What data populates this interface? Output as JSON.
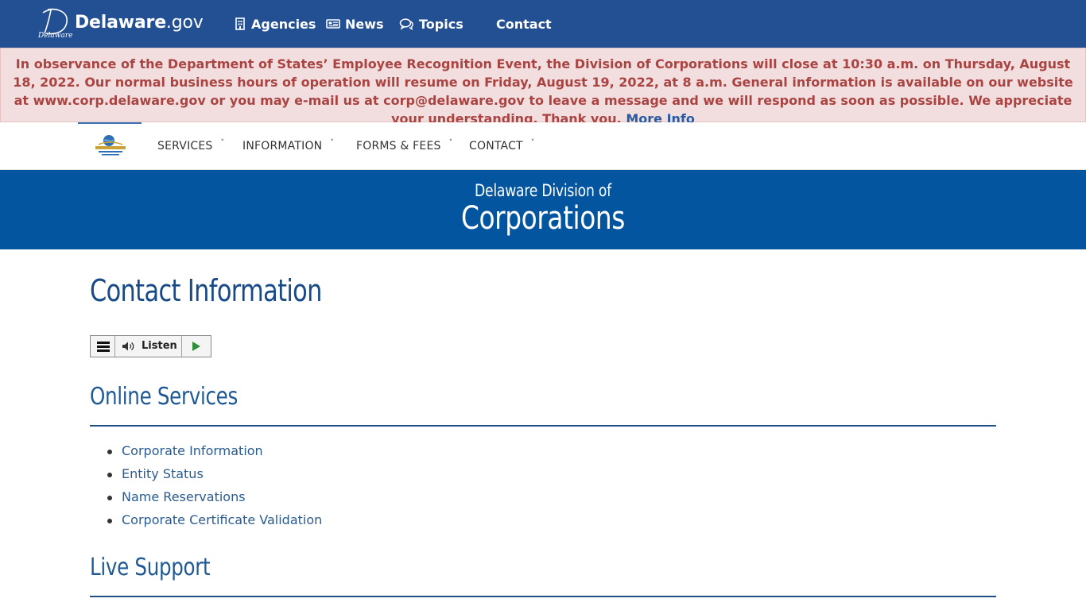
{
  "gov_bar": {
    "brand": "Delaware.gov",
    "brand_prefix": "Delaware",
    "brand_suffix": ".gov",
    "logo_caption": "Delaware",
    "nav": [
      {
        "label": "Agencies",
        "icon": "building-icon"
      },
      {
        "label": "News",
        "icon": "newspaper-icon"
      },
      {
        "label": "Topics",
        "icon": "chat-bubbles-icon"
      },
      {
        "label": "Contact",
        "icon": ""
      }
    ]
  },
  "alert": {
    "message": "In observance of the Department of States’ Employee Recognition Event, the Division of Corporations will close at 10:30 a.m. on Thursday, August 18, 2022. Our normal business hours of operation will resume on Friday, August 19, 2022, at 8 a.m. General information is available on our website at www.corp.delaware.gov or you may e-mail us at corp@delaware.gov to leave a message and we will respond as soon as possible. We appreciate your understanding. Thank you.",
    "more_link": "More Info"
  },
  "site_nav": {
    "items": [
      {
        "label": "SERVICES"
      },
      {
        "label": "INFORMATION"
      },
      {
        "label": "FORMS & FEES"
      },
      {
        "label": "CONTACT"
      }
    ],
    "caret": "˅"
  },
  "banner": {
    "line1": "Delaware Division of",
    "line2": "Corporations"
  },
  "main": {
    "title": "Contact Information",
    "listen_label": "Listen",
    "sections": [
      {
        "heading": "Online Services",
        "links": [
          "Corporate Information",
          "Entity Status",
          "Name Reservations",
          "Corporate Certificate Validation"
        ]
      },
      {
        "heading": "Live Support",
        "links": []
      }
    ]
  },
  "colors": {
    "gov_bar": "#234f93",
    "alert_bg": "#f2dede",
    "alert_text": "#a94442",
    "banner": "#0455a0",
    "heading": "#174a86",
    "link": "#2b5b8e"
  }
}
